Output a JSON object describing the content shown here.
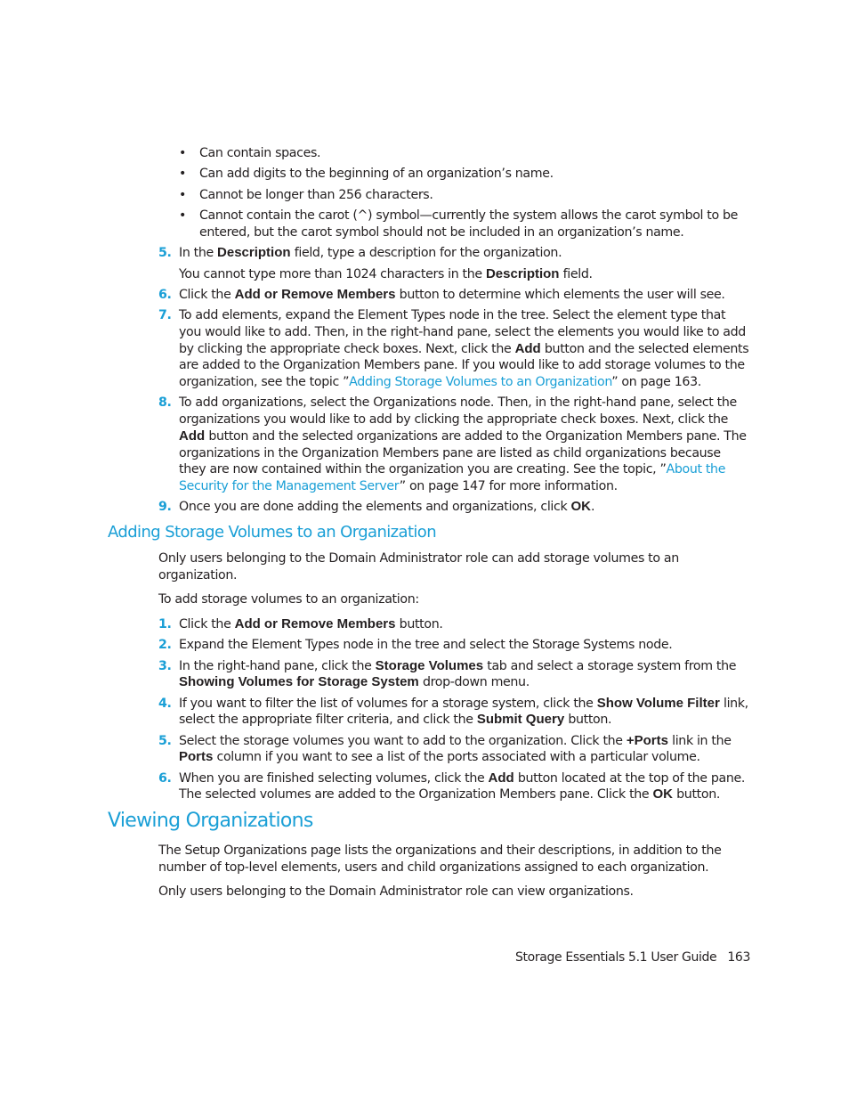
{
  "bullets": [
    "Can contain spaces.",
    "Can add digits to the beginning of an organization’s name.",
    "Cannot be longer than 256 characters.",
    "Cannot contain the carot (^) symbol—currently the system allows the carot symbol to be entered, but the carot symbol should not be included in an organization’s name."
  ],
  "bullet_glyph": "•",
  "steps_a": {
    "s5": {
      "num": "5.",
      "pre": "In the ",
      "bold": "Description",
      "post": " field, type a description for the organization.",
      "note_pre": "You cannot type more than 1024 characters in the ",
      "note_bold": "Description",
      "note_post": " field."
    },
    "s6": {
      "num": "6.",
      "pre": "Click the ",
      "bold": "Add or Remove Members",
      "post": " button to determine which elements the user will see."
    },
    "s7": {
      "num": "7.",
      "pre": "To add elements, expand the Element Types node in the tree. Select the element type that you would like to add. Then, in the right-hand pane, select the elements you would like to add by clicking the appropriate check boxes. Next, click the ",
      "bold": "Add",
      "mid": " button and the selected elements are added to the Organization Members pane. If you would like to add storage volumes to the organization, see the topic ”",
      "link": "Adding Storage Volumes to an Organization",
      "post": "” on page 163."
    },
    "s8": {
      "num": "8.",
      "pre": "To add organizations, select the Organizations node. Then, in the right-hand pane, select the organizations you would like to add by clicking the appropriate check boxes. Next, click the ",
      "bold": "Add",
      "mid": " button and the selected organizations are added to the Organization Members pane. The organizations in the Organization Members pane are listed as child organizations because they are now contained within the organization you are creating. See the topic, ”",
      "link": "About the Security for the Management Server",
      "post": "” on page 147 for more information."
    },
    "s9": {
      "num": "9.",
      "pre": "Once you are done adding the elements and organizations, click ",
      "bold": "OK",
      "post": "."
    }
  },
  "section_adding": {
    "heading": "Adding Storage Volumes to an Organization",
    "intro": "Only users belonging to the Domain Administrator role can add storage volumes to an organization.",
    "lead": "To add storage volumes to an organization:",
    "s1": {
      "num": "1.",
      "pre": "Click the ",
      "bold": "Add or Remove Members",
      "post": " button."
    },
    "s2": {
      "num": "2.",
      "text": "Expand the Element Types node in the tree and select the Storage Systems node."
    },
    "s3": {
      "num": "3.",
      "pre": "In the right-hand pane, click the ",
      "bold": "Storage Volumes",
      "mid": " tab and select a storage system from the ",
      "bold2": "Showing Volumes for Storage System",
      "post": " drop-down menu."
    },
    "s4": {
      "num": "4.",
      "pre": "If you want to filter the list of volumes for a storage system, click the ",
      "bold": "Show Volume Filter",
      "mid": " link, select the appropriate filter criteria, and click the ",
      "bold2": "Submit Query",
      "post": " button."
    },
    "s5": {
      "num": "5.",
      "pre": "Select the storage volumes you want to add to the organization. Click the ",
      "bold": "+Ports",
      "mid": " link in the ",
      "bold2": "Ports",
      "post": " column if you want to see a list of the ports associated with a particular volume."
    },
    "s6": {
      "num": "6.",
      "pre": "When you are finished selecting volumes, click the ",
      "bold": "Add",
      "mid": " button located at the top of the pane. The selected volumes are added to the Organization Members pane. Click the ",
      "bold2": "OK",
      "post": " button."
    }
  },
  "section_viewing": {
    "heading": "Viewing Organizations",
    "p1": "The Setup Organizations page lists the organizations and their descriptions, in addition to the number of top-level elements, users and child organizations assigned to each organization.",
    "p2": "Only users belonging to the Domain Administrator role can view organizations."
  },
  "footer": {
    "title": "Storage Essentials 5.1 User Guide",
    "page": "163"
  },
  "colors": {
    "accent": "#1a9fd6",
    "text": "#231f20"
  }
}
